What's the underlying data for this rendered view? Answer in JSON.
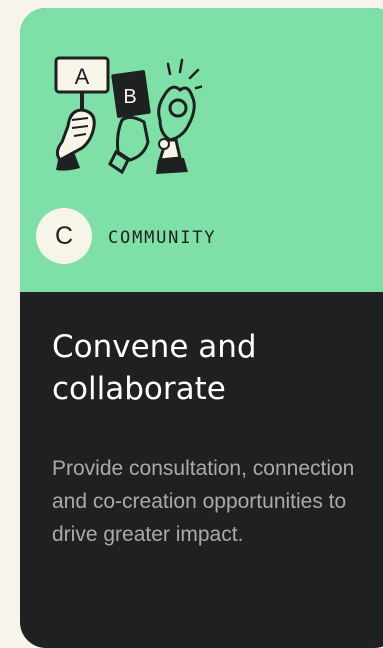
{
  "card": {
    "badge_letter": "C",
    "category": "COMMUNITY",
    "title": "Convene and collaborate",
    "description": "Provide consultation, connection and co-creation opportunities to drive greater impact.",
    "illustration": {
      "sign_a_label": "A",
      "sign_b_label": "B",
      "icon": "raised-hands-voting-icon"
    },
    "colors": {
      "top_background": "#7ee0a7",
      "bottom_background": "#1f2022",
      "badge_background": "#f7f4e8",
      "title_color": "#ffffff",
      "description_color": "#a9aaaa"
    }
  }
}
